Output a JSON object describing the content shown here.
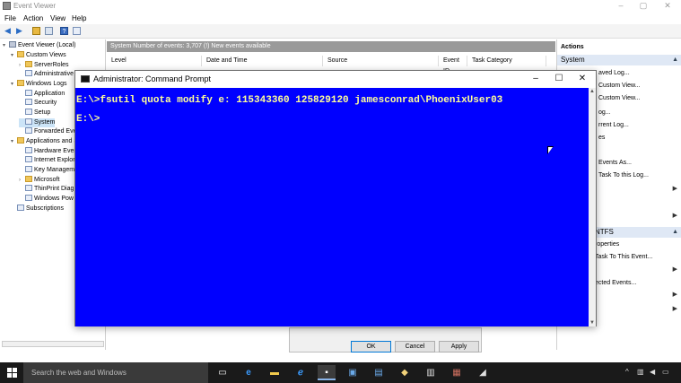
{
  "event_viewer": {
    "title": "Event Viewer",
    "menu": [
      "File",
      "Action",
      "View",
      "Help"
    ],
    "tree": [
      {
        "label": "Event Viewer (Local)",
        "icon": "computer-icon",
        "level": 0,
        "expander": "▾"
      },
      {
        "label": "Custom Views",
        "icon": "folder-icon",
        "level": 1,
        "expander": "▾"
      },
      {
        "label": "ServerRoles",
        "icon": "folder-icon",
        "level": 2,
        "expander": "›"
      },
      {
        "label": "Administrative",
        "icon": "log-icon",
        "level": 2,
        "expander": ""
      },
      {
        "label": "Windows Logs",
        "icon": "folder-icon",
        "level": 1,
        "expander": "▾"
      },
      {
        "label": "Application",
        "icon": "log-icon",
        "level": 2,
        "expander": ""
      },
      {
        "label": "Security",
        "icon": "log-icon",
        "level": 2,
        "expander": ""
      },
      {
        "label": "Setup",
        "icon": "log-icon",
        "level": 2,
        "expander": ""
      },
      {
        "label": "System",
        "icon": "log-icon",
        "level": 2,
        "expander": "",
        "selected": true
      },
      {
        "label": "Forwarded Eve",
        "icon": "log-icon",
        "level": 2,
        "expander": ""
      },
      {
        "label": "Applications and S",
        "icon": "folder-icon",
        "level": 1,
        "expander": "▾"
      },
      {
        "label": "Hardware Even",
        "icon": "log-icon",
        "level": 2,
        "expander": ""
      },
      {
        "label": "Internet Explor",
        "icon": "log-icon",
        "level": 2,
        "expander": ""
      },
      {
        "label": "Key Managem",
        "icon": "log-icon",
        "level": 2,
        "expander": ""
      },
      {
        "label": "Microsoft",
        "icon": "folder-icon",
        "level": 2,
        "expander": "›"
      },
      {
        "label": "ThinPrint Diag",
        "icon": "log-icon",
        "level": 2,
        "expander": ""
      },
      {
        "label": "Windows Pow",
        "icon": "log-icon",
        "level": 2,
        "expander": ""
      },
      {
        "label": "Subscriptions",
        "icon": "log-icon",
        "level": 1,
        "expander": ""
      }
    ],
    "center": {
      "info_bar": "System    Number of events: 3,707 (!) New events available",
      "columns": [
        "Level",
        "Date and Time",
        "Source",
        "Event ID",
        "Task Category"
      ]
    },
    "actions": {
      "header": "Actions",
      "section1": "System",
      "section1_items": [
        "aved Log...",
        "Custom View...",
        "Custom View...",
        "og...",
        "rrent Log...",
        "es",
        "Events As...",
        "Task To this Log..."
      ],
      "section2": "NTFS",
      "section2_items": [
        "roperties",
        "Task To This Event...",
        "ected Events..."
      ]
    },
    "dialog_buttons": {
      "ok": "OK",
      "cancel": "Cancel",
      "apply": "Apply"
    }
  },
  "cmd": {
    "title": "Administrator: Command Prompt",
    "line1": "E:\\>fsutil quota modify e: 115343360 125829120 jamesconrad\\PhoenixUser03",
    "line2": "E:\\>",
    "bg_color": "#0000ff",
    "text_color": "#ffff9a"
  },
  "taskbar": {
    "search_placeholder": "Search the web and Windows",
    "apps": [
      "task-view-icon",
      "edge-icon",
      "file-explorer-icon",
      "internet-explorer-icon",
      "command-prompt-icon",
      "app-icon",
      "app-icon",
      "app-icon",
      "app-icon",
      "app-icon",
      "app-icon"
    ]
  }
}
